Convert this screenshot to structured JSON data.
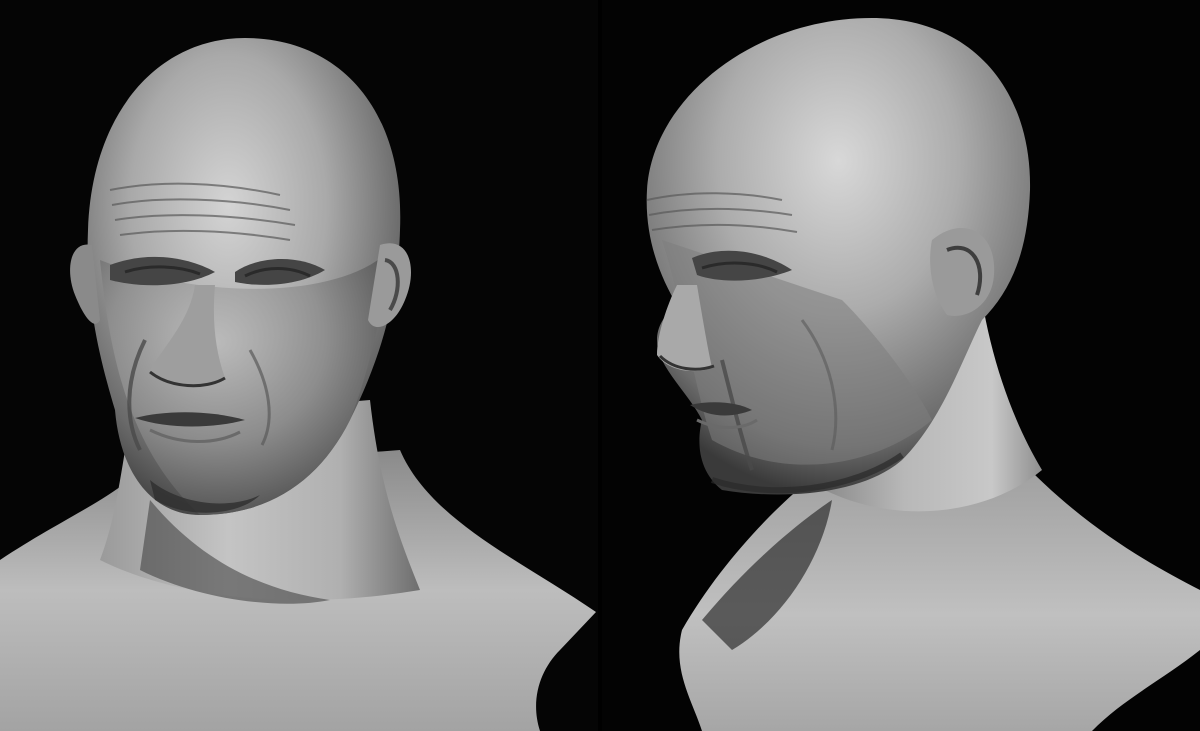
{
  "image": {
    "subject": "",
    "panels": [
      {
        "view": "front-three-quarter"
      },
      {
        "view": "side-three-quarter"
      }
    ],
    "colors": {
      "background": "#000000",
      "sculpt_highlight": "#d9d9d9",
      "sculpt_mid": "#8c8c8c",
      "sculpt_shadow": "#2e2e2e"
    }
  }
}
